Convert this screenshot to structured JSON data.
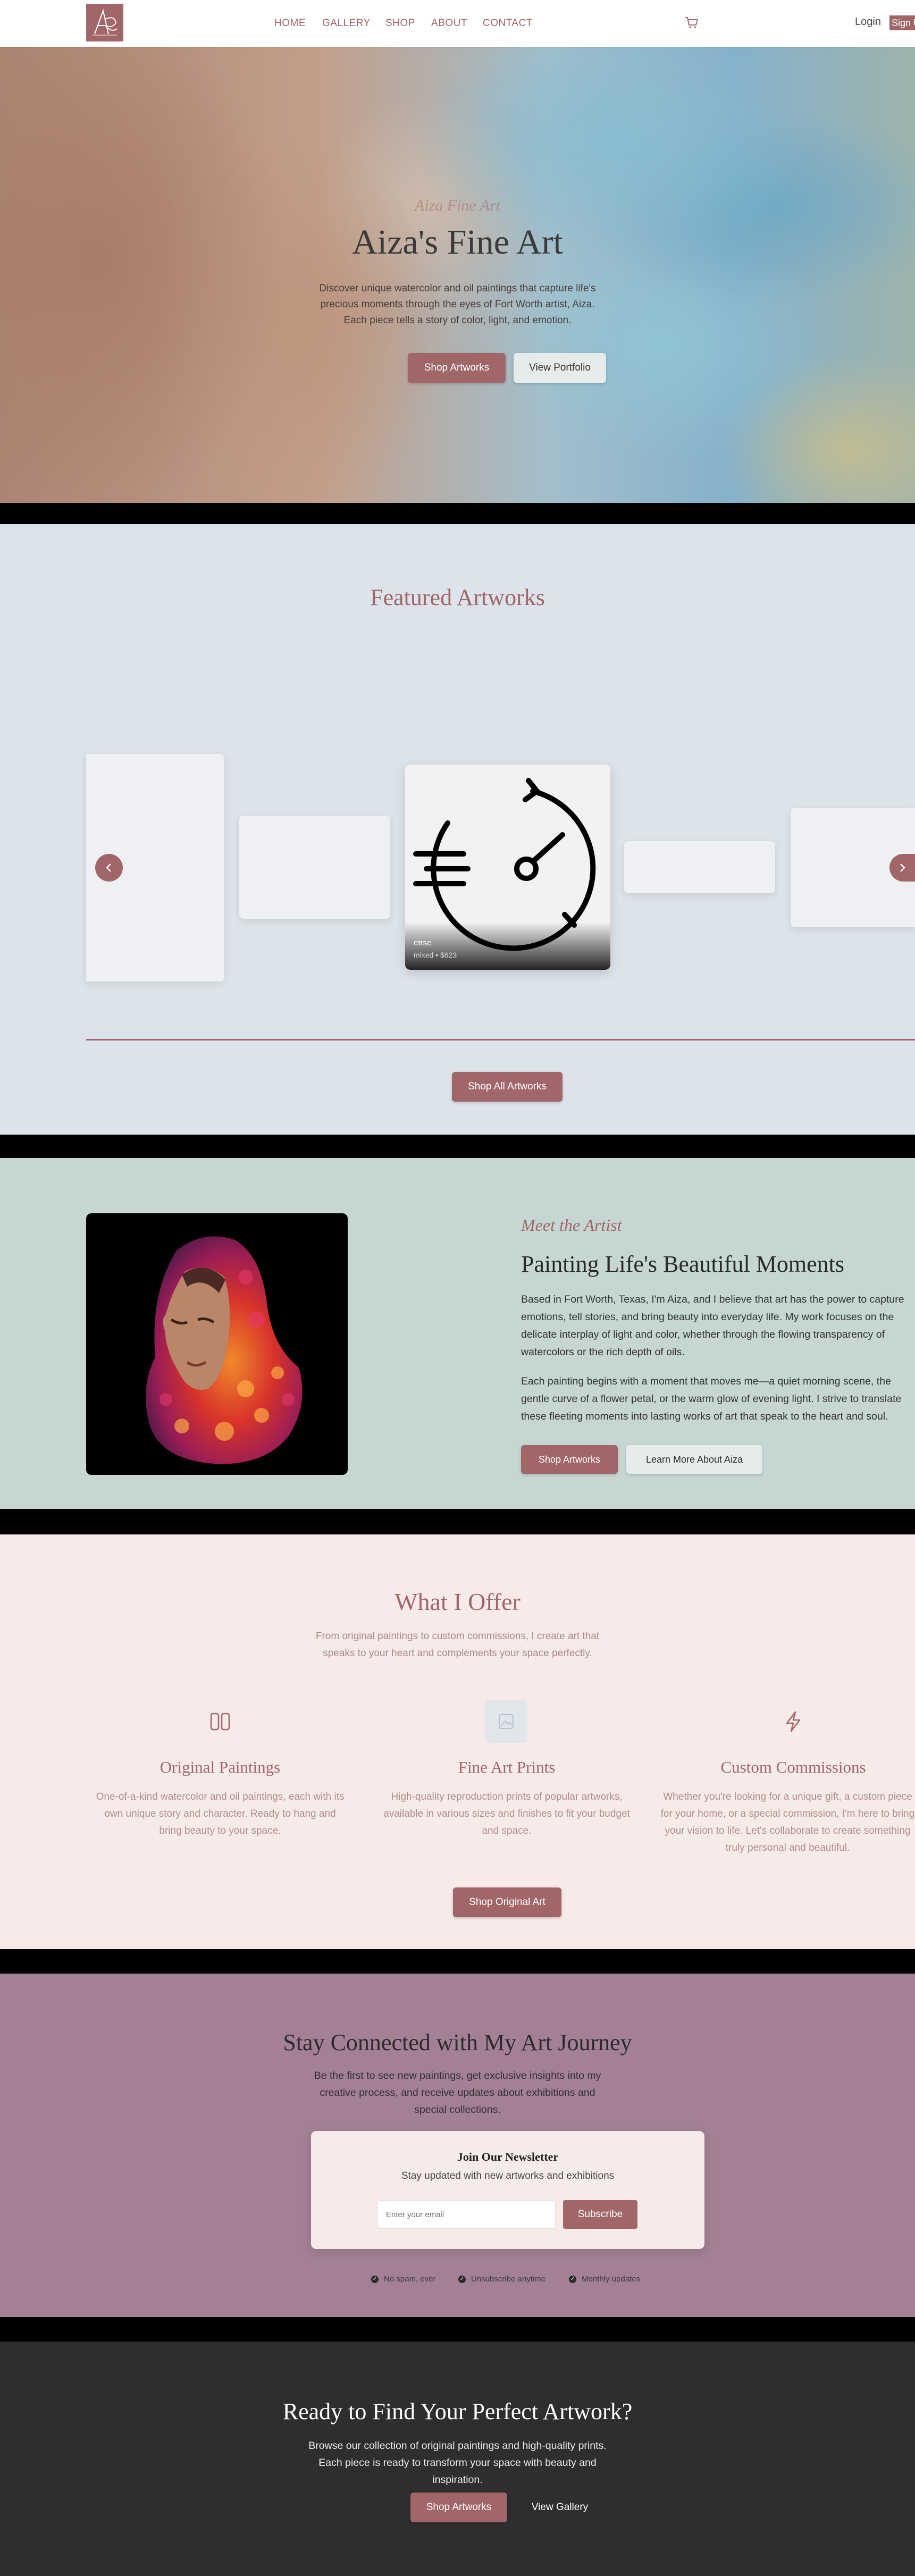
{
  "header": {
    "logo_text": "A",
    "nav": [
      "HOME",
      "GALLERY",
      "SHOP",
      "ABOUT",
      "CONTACT"
    ],
    "login": "Login",
    "signup": "Sign Up"
  },
  "hero": {
    "tagline": "Aiza Fine Art",
    "title": "Aiza's Fine Art",
    "description": "Discover unique watercolor and oil paintings that capture life's precious moments through the eyes of Fort Worth artist, Aiza. Each piece tells a story of color, light, and emotion.",
    "primary_button": "Shop Artworks",
    "secondary_button": "View Portfolio"
  },
  "featured": {
    "title": "Featured Artworks",
    "main_card": {
      "title": "etrse",
      "meta": "mixed • $623"
    },
    "prev_icon": "chevron-left-icon",
    "next_icon": "chevron-right-icon",
    "button": "Shop All Artworks"
  },
  "artist": {
    "kicker": "Meet the Artist",
    "title": "Painting Life's Beautiful Moments",
    "paragraph_1": "Based in Fort Worth, Texas, I'm Aiza, and I believe that art has the power to capture emotions, tell stories, and bring beauty into everyday life. My work focuses on the delicate interplay of light and color, whether through the flowing transparency of watercolors or the rich depth of oils.",
    "paragraph_2": "Each painting begins with a moment that moves me—a quiet morning scene, the gentle curve of a flower petal, or the warm glow of evening light. I strive to translate these fleeting moments into lasting works of art that speak to the heart and soul.",
    "primary_button": "Shop Artworks",
    "secondary_button": "Learn More About Aiza"
  },
  "offer": {
    "title": "What I Offer",
    "subtitle": "From original paintings to custom commissions, I create art that speaks to your heart and complements your space perfectly.",
    "services": [
      {
        "icon": "book-open-icon",
        "title": "Original Paintings",
        "description": "One-of-a-kind watercolor and oil paintings, each with its own unique story and character. Ready to hang and bring beauty to your space."
      },
      {
        "icon": "image-icon",
        "title": "Fine Art Prints",
        "description": "High-quality reproduction prints of popular artworks, available in various sizes and finishes to fit your budget and space."
      },
      {
        "icon": "lightning-icon",
        "title": "Custom Commissions",
        "description": "Whether you're looking for a unique gift, a custom piece for your home, or a special commission, I'm here to bring your vision to life. Let's collaborate to create something truly personal and beautiful."
      }
    ],
    "button": "Shop Original Art"
  },
  "newsletter": {
    "title": "Stay Connected with My Art Journey",
    "description": "Be the first to see new paintings, get exclusive insights into my creative process, and receive updates about exhibitions and special collections.",
    "box_title": "Join Our Newsletter",
    "box_subtitle": "Stay updated with new artworks and exhibitions",
    "input_placeholder": "Enter your email",
    "button": "Subscribe",
    "perks": [
      "No spam, ever",
      "Unsubscribe anytime",
      "Monthly updates"
    ]
  },
  "cta": {
    "title": "Ready to Find Your Perfect Artwork?",
    "description": "Browse our collection of original paintings and high-quality prints. Each piece is ready to transform your space with beauty and inspiration.",
    "primary_button": "Shop Artworks",
    "secondary_button": "View Gallery"
  },
  "colors": {
    "accent": "#a06668",
    "featured_bg": "#dde3ea",
    "artist_bg": "#c6d6d3",
    "offer_bg": "#f6ebe9",
    "newsletter_bg": "#a38095",
    "cta_bg": "#2e2e30"
  }
}
